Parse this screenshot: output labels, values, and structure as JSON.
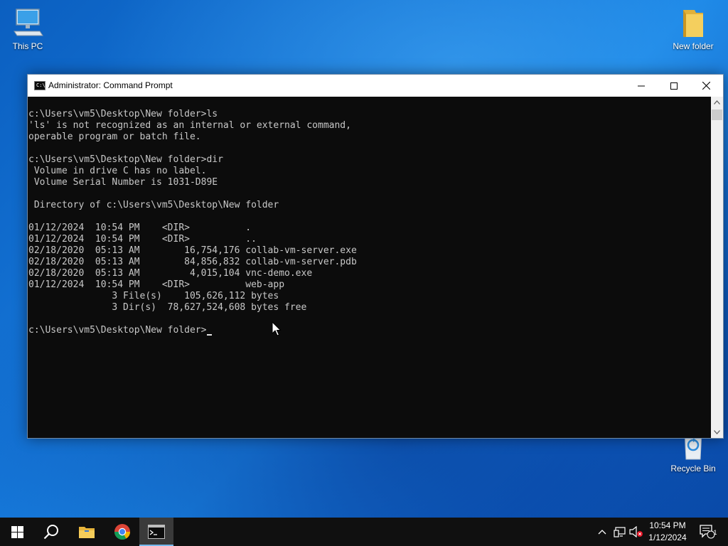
{
  "desktop": {
    "icons": [
      {
        "label": "This PC",
        "icon": "computer-icon"
      },
      {
        "label": "New folder",
        "icon": "folder-icon"
      },
      {
        "label": "Recycle Bin",
        "icon": "recycle-bin-icon"
      }
    ]
  },
  "window": {
    "title": "Administrator: Command Prompt",
    "icon": "command-prompt-icon",
    "controls": [
      "minimize-icon",
      "maximize-icon",
      "close-icon"
    ],
    "colors": {
      "background": "#0c0c0c",
      "text": "#c8c8c8",
      "titlebar": "#ffffff"
    }
  },
  "console": {
    "lines": [
      "c:\\Users\\vm5\\Desktop\\New folder>ls",
      "'ls' is not recognized as an internal or external command,",
      "operable program or batch file.",
      "",
      "c:\\Users\\vm5\\Desktop\\New folder>dir",
      " Volume in drive C has no label.",
      " Volume Serial Number is 1031-D89E",
      "",
      " Directory of c:\\Users\\vm5\\Desktop\\New folder",
      "",
      "01/12/2024  10:54 PM    <DIR>          .",
      "01/12/2024  10:54 PM    <DIR>          ..",
      "02/18/2020  05:13 AM        16,754,176 collab-vm-server.exe",
      "02/18/2020  05:13 AM        84,856,832 collab-vm-server.pdb",
      "02/18/2020  05:13 AM         4,015,104 vnc-demo.exe",
      "01/12/2024  10:54 PM    <DIR>          web-app",
      "               3 File(s)    105,626,112 bytes",
      "               3 Dir(s)  78,627,524,608 bytes free",
      "",
      "c:\\Users\\vm5\\Desktop\\New folder>"
    ]
  },
  "taskbar": {
    "buttons": [
      "windows-start-icon",
      "search-icon",
      "file-explorer-icon",
      "chrome-icon",
      "command-prompt-icon"
    ],
    "active": "command-prompt-icon",
    "tray": [
      "chevron-up-icon",
      "network-icon",
      "volume-muted-icon"
    ],
    "clock": {
      "time": "10:54 PM",
      "date": "1/12/2024"
    },
    "notifications": {
      "icon": "action-center-icon",
      "count": "1"
    }
  },
  "colors": {
    "accent": "#76b9ed",
    "taskbar": "#101010",
    "desktop": "#1577d9"
  }
}
